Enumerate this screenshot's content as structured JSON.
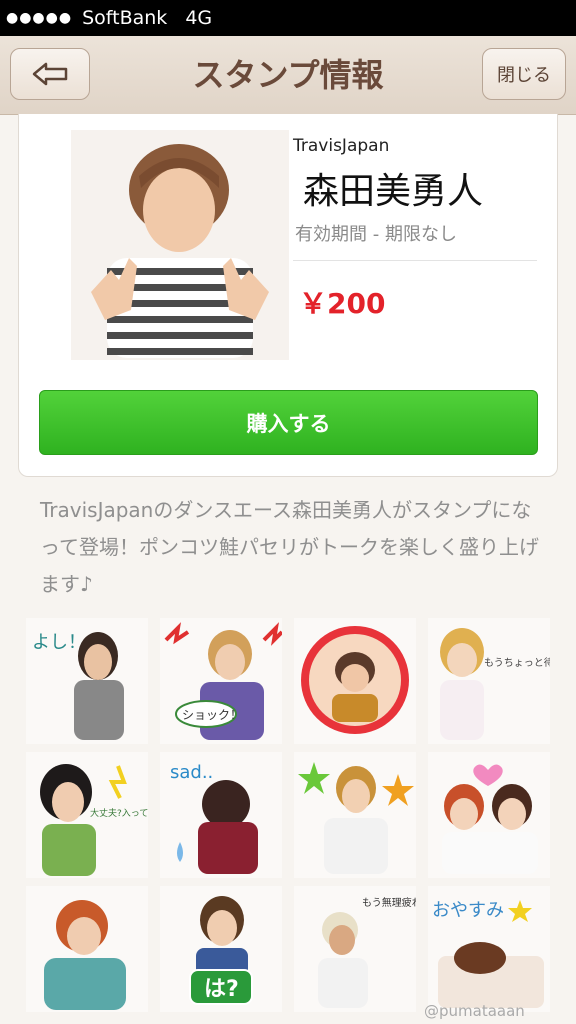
{
  "status_bar": {
    "signal": "●●●●●",
    "carrier": "SoftBank",
    "network": "4G"
  },
  "navbar": {
    "back_icon": "back-arrow-icon",
    "title": "スタンプ情報",
    "close_label": "閉じる"
  },
  "sticker": {
    "author": "TravisJapan",
    "name": "森田美勇人",
    "validity": "有効期間 - 期限なし",
    "price": "￥200",
    "buy_label": "購入する",
    "price_color": "#e3222a",
    "buy_color": "#3cc22a"
  },
  "description": "TravisJapanのダンスエース森田美勇人がスタンプになって登場！ポンコツ鮭パセリがトークを楽しく盛り上げます♪",
  "stickers": [
    {
      "text": "よし！"
    },
    {
      "text": "ショック！"
    },
    {
      "text": ""
    },
    {
      "text": "もうちょっと待ってて♥"
    },
    {
      "text": "大丈夫?入ってない?"
    },
    {
      "text": "sad.."
    },
    {
      "text": ""
    },
    {
      "text": ""
    },
    {
      "text": ""
    },
    {
      "text": "は?"
    },
    {
      "text": "もう無理疲れた"
    },
    {
      "text": "おやすみ"
    }
  ],
  "watermark": "@pumataaan"
}
